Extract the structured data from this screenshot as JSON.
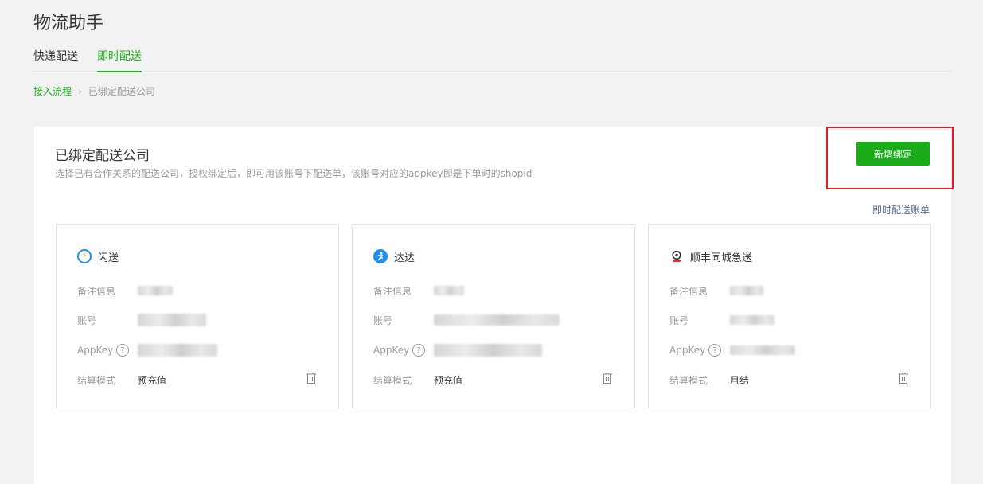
{
  "page": {
    "title": "物流助手"
  },
  "tabs": [
    {
      "label": "快递配送",
      "active": false
    },
    {
      "label": "即时配送",
      "active": true
    }
  ],
  "breadcrumb": {
    "link": "接入流程",
    "separator": "›",
    "current": "已绑定配送公司"
  },
  "panel": {
    "title": "已绑定配送公司",
    "description": "选择已有合作关系的配送公司，授权绑定后，即可用该账号下配送单，该账号对应的appkey即是下单时的shopid",
    "add_button": "新增绑定",
    "bill_link": "即时配送账单"
  },
  "labels": {
    "remark": "备注信息",
    "account": "账号",
    "appkey": "AppKey",
    "settlement": "结算模式",
    "help": "?"
  },
  "cards": [
    {
      "name": "闪送",
      "icon": "lightning-icon",
      "settlement_mode": "预充值"
    },
    {
      "name": "达达",
      "icon": "courier-icon",
      "settlement_mode": "预充值"
    },
    {
      "name": "顺丰同城急送",
      "icon": "sf-logo-icon",
      "settlement_mode": "月结"
    }
  ],
  "colors": {
    "accent": "#1aad19",
    "link": "#576b95",
    "highlight": "#e02020"
  }
}
